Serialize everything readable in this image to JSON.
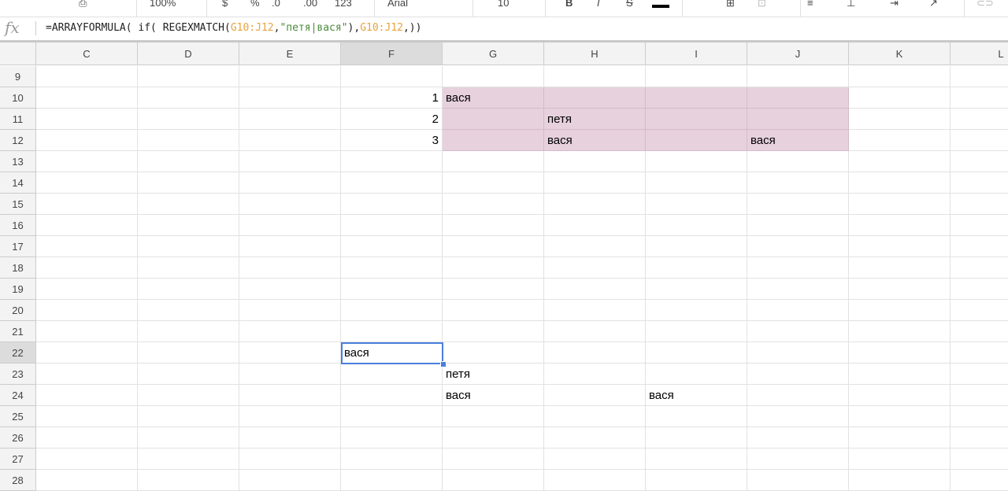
{
  "toolbar": {
    "zoom": "100%",
    "font": "Arial",
    "font_size": "10",
    "format_123": "123"
  },
  "formula_bar": {
    "fx": "fx",
    "parts": [
      {
        "t": "=ARRAYFORMULA( if( REGEXMATCH(",
        "c": ""
      },
      {
        "t": "G10:J12",
        "c": "ref"
      },
      {
        "t": ",",
        "c": ""
      },
      {
        "t": "\"петя|вася\"",
        "c": "str"
      },
      {
        "t": "),",
        "c": ""
      },
      {
        "t": "G10:J12",
        "c": "ref"
      },
      {
        "t": ",))",
        "c": ""
      }
    ]
  },
  "columns": [
    "C",
    "D",
    "E",
    "F",
    "G",
    "H",
    "I",
    "J",
    "K",
    "L"
  ],
  "rows": [
    9,
    10,
    11,
    12,
    13,
    14,
    15,
    16,
    17,
    18,
    19,
    20,
    21,
    22,
    23,
    24,
    25,
    26,
    27,
    28
  ],
  "selected": {
    "col": "F",
    "row": 22
  },
  "fill_color": "#e6d1dc",
  "fill_range": {
    "cols": [
      "G",
      "H",
      "I",
      "J"
    ],
    "rows": [
      10,
      11,
      12
    ]
  },
  "cells": [
    {
      "ref": "F10",
      "value": "1",
      "num": true
    },
    {
      "ref": "G10",
      "value": "вася"
    },
    {
      "ref": "F11",
      "value": "2",
      "num": true
    },
    {
      "ref": "H11",
      "value": "петя"
    },
    {
      "ref": "F12",
      "value": "3",
      "num": true
    },
    {
      "ref": "H12",
      "value": "вася"
    },
    {
      "ref": "J12",
      "value": "вася"
    },
    {
      "ref": "F22",
      "value": "вася"
    },
    {
      "ref": "G23",
      "value": "петя"
    },
    {
      "ref": "G24",
      "value": "вася"
    },
    {
      "ref": "I24",
      "value": "вася"
    }
  ]
}
